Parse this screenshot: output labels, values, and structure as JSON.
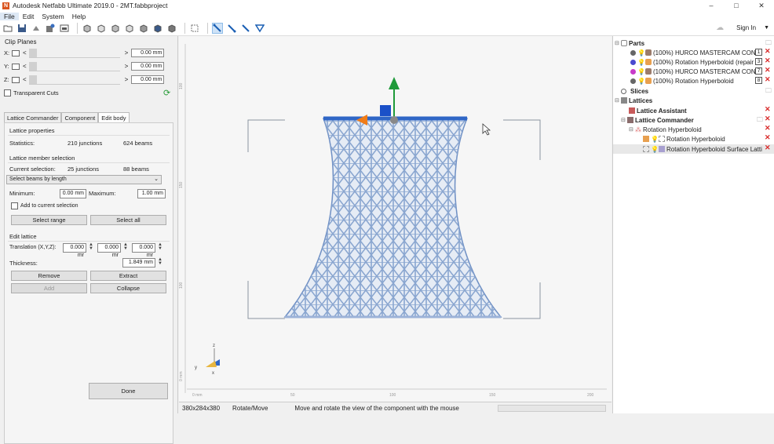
{
  "window": {
    "title": "Autodesk Netfabb Ultimate 2019.0 - 2MT.fabbproject",
    "min": "–",
    "max": "□",
    "close": "✕"
  },
  "menu": [
    "File",
    "Edit",
    "System",
    "Help"
  ],
  "signin": {
    "label": "Sign In"
  },
  "clip_planes": {
    "title": "Clip Planes",
    "rows": [
      {
        "axis": "X:",
        "value": "0.00 mm"
      },
      {
        "axis": "Y:",
        "value": "0.00 mm"
      },
      {
        "axis": "Z:",
        "value": "0.00 mm"
      }
    ],
    "transparent_cuts": "Transparent Cuts"
  },
  "tabs": [
    "Lattice Commander",
    "Component",
    "Edit body"
  ],
  "lattice": {
    "properties_title": "Lattice properties",
    "statistics_label": "Statistics:",
    "junctions": "210 junctions",
    "beams": "624 beams",
    "member_title": "Lattice member selection",
    "current_label": "Current selection:",
    "cur_junctions": "25 junctions",
    "cur_beams": "88 beams",
    "select_mode": "Select beams by length",
    "min_label": "Minimum:",
    "min_value": "0.00 mm",
    "max_label": "Maximum:",
    "max_value": "1.00 mm",
    "add_to_sel": "Add to current selection",
    "select_range": "Select range",
    "select_all": "Select all",
    "edit_title": "Edit lattice",
    "translation_label": "Translation (X,Y,Z):",
    "tx": "0.000 mr",
    "ty": "0.000 mr",
    "tz": "0.000 mr",
    "thickness_label": "Thickness:",
    "thickness": "1.849 mm",
    "remove": "Remove",
    "extract": "Extract",
    "add": "Add",
    "collapse": "Collapse",
    "done": "Done"
  },
  "viewport": {
    "ruler_bottom": [
      "0 mm",
      "50",
      "100",
      "150",
      "200"
    ],
    "ruler_left": [
      "100",
      "150",
      "100",
      "50",
      "0 mm"
    ],
    "axis_z": "z",
    "axis_y": "y",
    "axis_x": "x"
  },
  "status": {
    "dims": "380x284x380",
    "mode": "Rotate/Move",
    "hint": "Move and rotate the view of the component with the mouse"
  },
  "tree": {
    "parts": "Parts",
    "items": [
      {
        "label": "(100%) HURCO MASTERCAM CON R",
        "color": "#666666",
        "num": "1"
      },
      {
        "label": "(100%) Rotation Hyperboloid (repair",
        "color": "#4a4ad0",
        "num": "3"
      },
      {
        "label": "(100%) HURCO MASTERCAM CON R",
        "color": "#c83ac8",
        "num": "7"
      },
      {
        "label": "(100%) Rotation Hyperboloid",
        "color": "#666666",
        "num": "8"
      }
    ],
    "slices": "Slices",
    "lattices": "Lattices",
    "lattice_assistant": "Lattice Assistant",
    "lattice_commander": "Lattice Commander",
    "rot_hyper": "Rotation Hyperboloid",
    "rot_hyper_child": "Rotation Hyperboloid",
    "rot_hyper_surface": "Rotation Hyperboloid Surface Latti"
  }
}
